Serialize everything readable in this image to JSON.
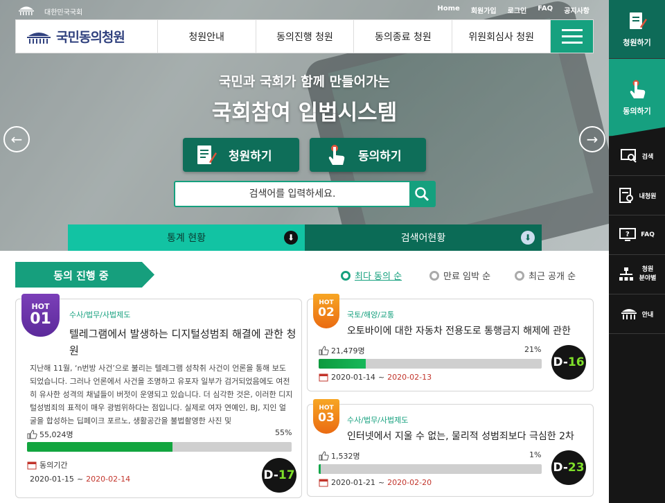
{
  "topbar": {
    "assembly_name": "대한민국국회",
    "links": [
      "Home",
      "회원가입",
      "로그인",
      "FAQ",
      "공지사항"
    ]
  },
  "nav": {
    "logo_text": "국민동의청원",
    "items": [
      "청원안내",
      "동의진행 청원",
      "동의종료 청원",
      "위원회심사 청원"
    ]
  },
  "hero": {
    "subtitle": "국민과 국회가 함께 만들어가는",
    "title": "국회참여 입법시스템",
    "petition_button": "청원하기",
    "agree_button": "동의하기",
    "search_placeholder": "검색어를 입력하세요.",
    "tab_stats": "통계 현황",
    "tab_keywords": "검색어현황"
  },
  "rail": {
    "petition": "청원하기",
    "agree": "동의하기",
    "search": "검색",
    "my_petition": "내청원",
    "faq": "FAQ",
    "field_line1": "청원",
    "field_line2": "분야별",
    "guide": "안내"
  },
  "section": {
    "title": "동의 진행 중",
    "sort_options": [
      "최다 동의 순",
      "만료 임박 순",
      "최근 공개 순"
    ],
    "selected_sort": "최다 동의 순"
  },
  "petitions": [
    {
      "hot_label": "HOT",
      "rank": "01",
      "category": "수사/법무/사법제도",
      "title": "텔레그램에서 발생하는 디지털성범죄 해결에 관한 청원",
      "summary": "지난해 11월, ‘n번방 사건’으로 불리는 텔레그램 성착취 사건이 언론을 통해 보도되었습니다. 그러나 언론에서 사건을 조명하고 유포자 일부가 검거되었음에도 여전히 유사한 성격의 채널들이 버젓이 운영되고 있습니다. 더 심각한 것은, 이러한 디지털성범죄의 표적이 매우 광범위하다는 점입니다. 실제로 여자 연예인, BJ, 지인 얼굴을 합성하는 딥페이크 포르노, 생활공간을 불법촬영한 사진 및",
      "agree_count": "55,024명",
      "percent_text": "55%",
      "percent": 0.55,
      "period_label": "동의기간",
      "start": "2020-01-15",
      "sep": " ~ ",
      "end": "2020-02-14",
      "dday_prefix": "D-",
      "dday_num": "17"
    },
    {
      "hot_label": "HOT",
      "rank": "02",
      "category": "국토/해양/교통",
      "title": "오토바이에 대한 자동차 전용도로 통행금지 해제에 관한",
      "agree_count": "21,479명",
      "percent_text": "21%",
      "percent": 0.21,
      "start": "2020-01-14",
      "sep": " ~ ",
      "end": "2020-02-13",
      "dday_prefix": "D-",
      "dday_num": "16"
    },
    {
      "hot_label": "HOT",
      "rank": "03",
      "category": "수사/법무/사법제도",
      "title": "인터넷에서 지울 수 없는, 물리적 성범죄보다 극심한 2차",
      "agree_count": "1,532명",
      "percent_text": "1%",
      "percent": 0.01,
      "start": "2020-01-21",
      "sep": " ~ ",
      "end": "2020-02-20",
      "dday_prefix": "D-",
      "dday_num": "23"
    }
  ],
  "colors": {
    "brand_green": "#16a080",
    "dark_green": "#0e6b58",
    "hot_purple": "#6b35a9",
    "hot_orange": "#f08a1c",
    "bar_fill": "#12a53f",
    "end_date_red": "#c2342b"
  }
}
